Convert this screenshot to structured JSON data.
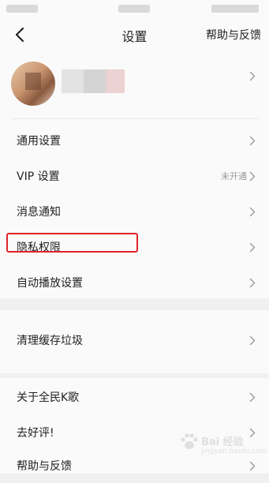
{
  "nav": {
    "title": "设置",
    "help_label": "帮助与反馈"
  },
  "profile": {
    "avatar_icon": "user-avatar",
    "nickname": ""
  },
  "menu": {
    "general": {
      "label": "通用设置"
    },
    "vip": {
      "label": "VIP 设置",
      "value": "未开通"
    },
    "notifications": {
      "label": "消息通知"
    },
    "privacy": {
      "label": "隐私权限"
    },
    "autoplay": {
      "label": "自动播放设置"
    },
    "cache": {
      "label": "清理缓存垃圾"
    },
    "about": {
      "label": "关于全民K歌"
    },
    "rate": {
      "label": "去好评!"
    },
    "help": {
      "label": "帮助与反馈"
    }
  },
  "highlight": {
    "color": "#e0242b",
    "target": "privacy"
  },
  "watermark": {
    "text": "Bai 经验",
    "sub": "jingyan.baidu.com"
  },
  "colors": {
    "background": "#f0f0f0",
    "card": "#fafafa",
    "text": "#222222",
    "secondary_text": "#999999",
    "highlight": "#e0242b"
  }
}
